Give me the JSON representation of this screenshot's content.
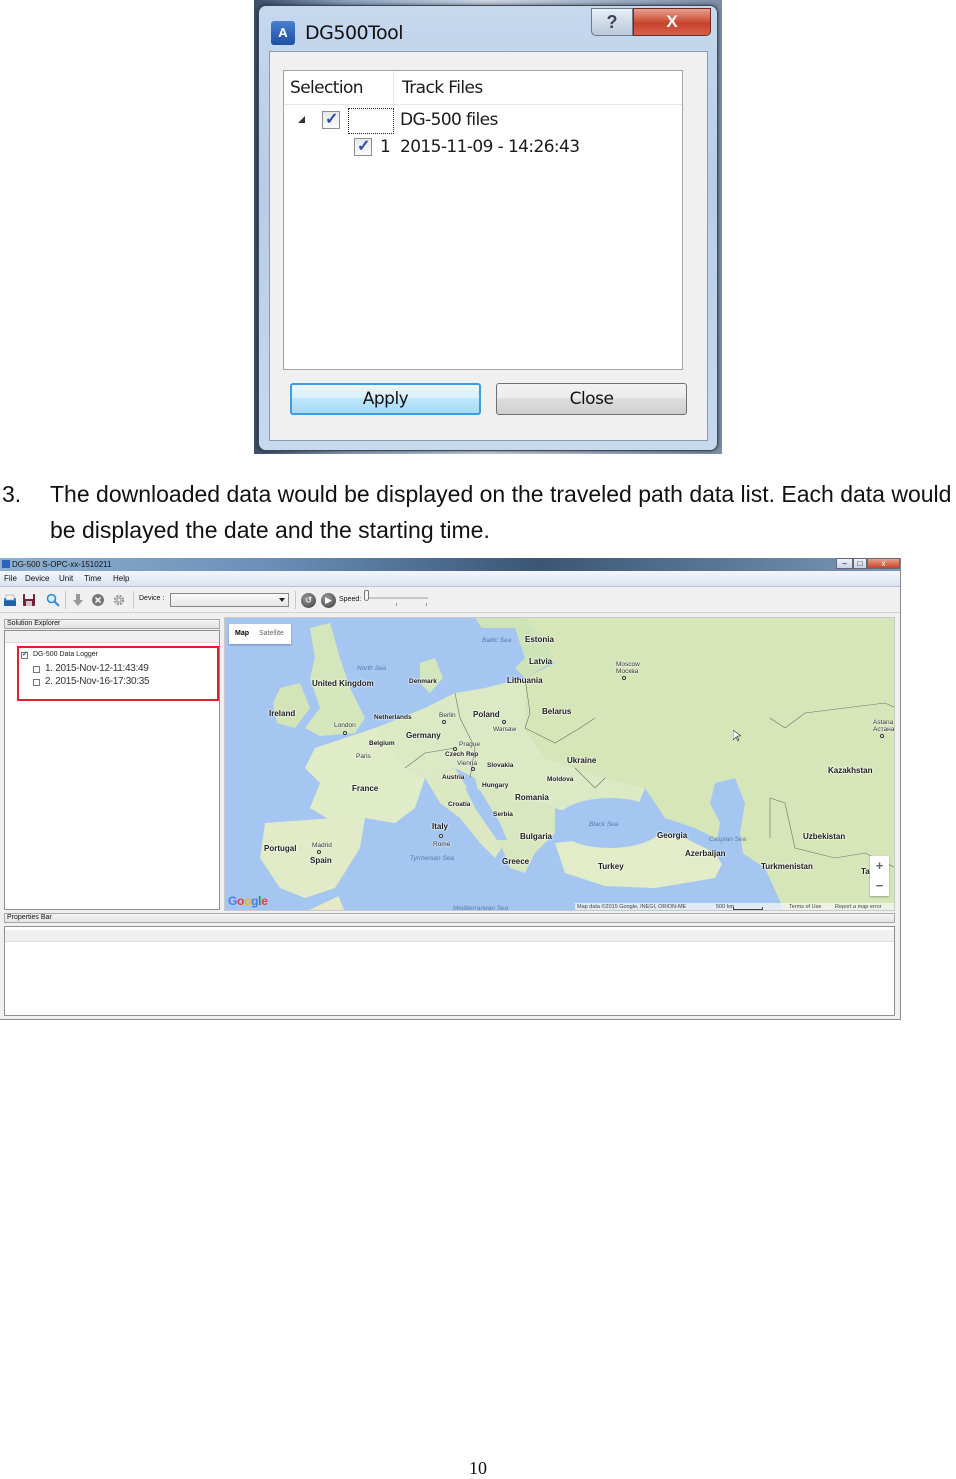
{
  "dialog": {
    "title": "DG500Tool",
    "help_label": "?",
    "close_label": "X",
    "tree": {
      "columns": [
        "Selection",
        "Track Files"
      ],
      "root": {
        "label": "DG-500 files",
        "checked": true,
        "expanded": true
      },
      "items": [
        {
          "index": "1",
          "label": "2015-11-09 - 14:26:43",
          "checked": true
        }
      ]
    },
    "buttons": {
      "apply": "Apply",
      "close": "Close"
    }
  },
  "paragraph": {
    "number": "3.",
    "text": "The downloaded data would be displayed on the traveled path data list. Each data would be displayed the date and the starting time."
  },
  "app": {
    "title": "DG-500 S-OPC-xx-1510211",
    "window_controls": {
      "minimize": "–",
      "maximize": "□",
      "close": "x"
    },
    "menu": [
      "File",
      "Device",
      "Unit",
      "Time",
      "Help"
    ],
    "toolbar": {
      "icons": [
        "open-icon",
        "save-icon",
        "search-icon",
        "download-icon",
        "delete-icon",
        "settings-icon"
      ],
      "device_label": "Device :",
      "device_value": "",
      "speed_label": "Speed:",
      "speed_value": 0
    },
    "solution_explorer": {
      "title": "Solution Explorer",
      "root": {
        "label": "DG-500 Data Logger",
        "checked": true
      },
      "items": [
        {
          "label": "1. 2015-Nov-12-11:43:49",
          "checked": false
        },
        {
          "label": "2. 2015-Nov-16-17:30:35",
          "checked": false
        }
      ]
    },
    "map": {
      "type_buttons": [
        "Map",
        "Satellite"
      ],
      "active_type": "Map",
      "countries": [
        "Estonia",
        "Latvia",
        "Lithuania",
        "United Kingdom",
        "Ireland",
        "Denmark",
        "Netherlands",
        "Belgium",
        "Germany",
        "Poland",
        "Belarus",
        "Czech Rep",
        "Slovakia",
        "Austria",
        "Hungary",
        "Ukraine",
        "Moldova",
        "Romania",
        "France",
        "Croatia",
        "Serbia",
        "Italy",
        "Bulgaria",
        "Greece",
        "Turkey",
        "Portugal",
        "Spain",
        "Georgia",
        "Azerbaijan",
        "Kazakhstan",
        "Uzbekistan",
        "Turkmenistan",
        "Ta"
      ],
      "cities": [
        "London",
        "Paris",
        "Berlin",
        "Warsaw",
        "Prague",
        "Vienna",
        "Rome",
        "Madrid",
        "Moscow",
        "Москва",
        "Astana",
        "Астана"
      ],
      "seas": [
        "North Sea",
        "Baltic Sea",
        "Black Sea",
        "Caspian Sea",
        "Tyrrhenian Sea",
        "Mediterranean Sea"
      ],
      "logo": "Google",
      "attribution": "Map data ©2015 Google, INEGI, ORION-ME",
      "scale": "500 km",
      "terms": "Terms of Use",
      "report": "Report a map error",
      "zoom_in": "+",
      "zoom_out": "−"
    },
    "properties_bar": {
      "title": "Properties Bar"
    }
  },
  "page_number": "10"
}
